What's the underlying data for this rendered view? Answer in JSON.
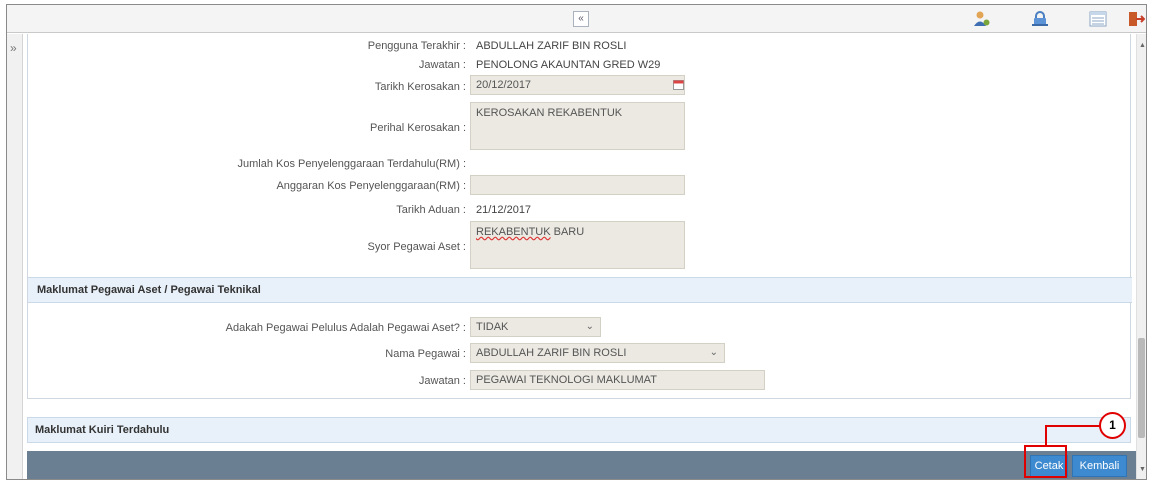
{
  "toolbar": {
    "collapse_glyph": "«",
    "icons": [
      "user-settings-icon",
      "lock-icon",
      "list-view-icon",
      "logout-icon"
    ]
  },
  "sidebar": {
    "expand_glyph": "»"
  },
  "form": {
    "pengguna_terakhir": {
      "label": "Pengguna Terakhir :",
      "value": "ABDULLAH ZARIF BIN ROSLI"
    },
    "jawatan1": {
      "label": "Jawatan :",
      "value": "PENOLONG AKAUNTAN GRED W29"
    },
    "tarikh_kerosakan": {
      "label": "Tarikh Kerosakan :",
      "value": "20/12/2017"
    },
    "perihal_kerosakan": {
      "label": "Perihal Kerosakan :",
      "value": "KEROSAKAN REKABENTUK"
    },
    "jumlah_kos": {
      "label": "Jumlah Kos Penyelenggaraan Terdahulu(RM) :",
      "value": ""
    },
    "anggaran_kos": {
      "label": "Anggaran Kos Penyelenggaraan(RM) :",
      "value": ""
    },
    "tarikh_aduan": {
      "label": "Tarikh Aduan :",
      "value": "21/12/2017"
    },
    "syor_pegawai": {
      "label": "Syor Pegawai Aset :",
      "value_underlined": "REKABENTUK",
      "value_rest": " BARU"
    }
  },
  "section_pegawai": {
    "title": "Maklumat Pegawai Aset / Pegawai Teknikal",
    "adakah": {
      "label": "Adakah Pegawai Pelulus Adalah Pegawai Aset? :",
      "value": "TIDAK"
    },
    "nama": {
      "label": "Nama Pegawai :",
      "value": "ABDULLAH ZARIF BIN ROSLI"
    },
    "jawatan": {
      "label": "Jawatan :",
      "value": "PEGAWAI TEKNOLOGI MAKLUMAT"
    }
  },
  "section_kuiri": {
    "title": "Maklumat Kuiri Terdahulu"
  },
  "footer": {
    "cetak_label": "Cetak",
    "kembali_label": "Kembali"
  },
  "callout": {
    "number": "1"
  },
  "colors": {
    "highlight": "#e00000",
    "button": "#3e8ad0",
    "footer_bar": "#6a7f92",
    "section_bg": "#e8f1f9"
  }
}
